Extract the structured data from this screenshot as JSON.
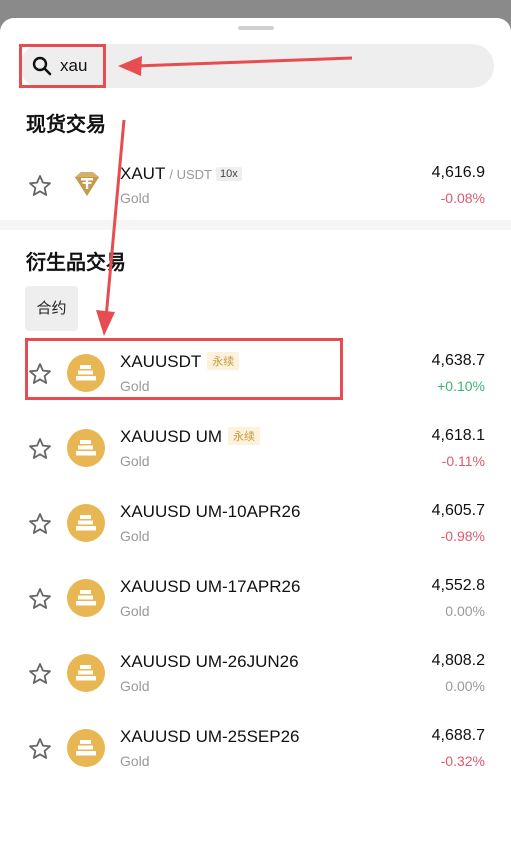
{
  "search": {
    "value": "xau"
  },
  "spot": {
    "title": "现货交易",
    "item": {
      "symbol": "XAUT",
      "pair": "/ USDT",
      "leverage": "10x",
      "sub": "Gold",
      "price": "4,616.9",
      "change": "-0.08%"
    }
  },
  "derivatives": {
    "title": "衍生品交易",
    "tab": "合约",
    "badge": "永续",
    "items": [
      {
        "symbol": "XAUUSDT",
        "sub": "Gold",
        "price": "4,638.7",
        "change": "+0.10%"
      },
      {
        "symbol": "XAUUSD UM",
        "sub": "Gold",
        "price": "4,618.1",
        "change": "-0.11%"
      },
      {
        "symbol": "XAUUSD UM-10APR26",
        "sub": "Gold",
        "price": "4,605.7",
        "change": "-0.98%"
      },
      {
        "symbol": "XAUUSD UM-17APR26",
        "sub": "Gold",
        "price": "4,552.8",
        "change": "0.00%"
      },
      {
        "symbol": "XAUUSD UM-26JUN26",
        "sub": "Gold",
        "price": "4,808.2",
        "change": "0.00%"
      },
      {
        "symbol": "XAUUSD UM-25SEP26",
        "sub": "Gold",
        "price": "4,688.7",
        "change": "-0.32%"
      }
    ]
  },
  "colors": {
    "up": "#3eb474",
    "down": "#e0596f",
    "flat": "#999999",
    "coin": "#e8b653",
    "annotation": "#e74c50"
  },
  "icons": {
    "search": "search-icon",
    "star": "star-outline-icon",
    "coin": "gold-bar-icon",
    "spot_coin": "tether-gold-icon"
  }
}
